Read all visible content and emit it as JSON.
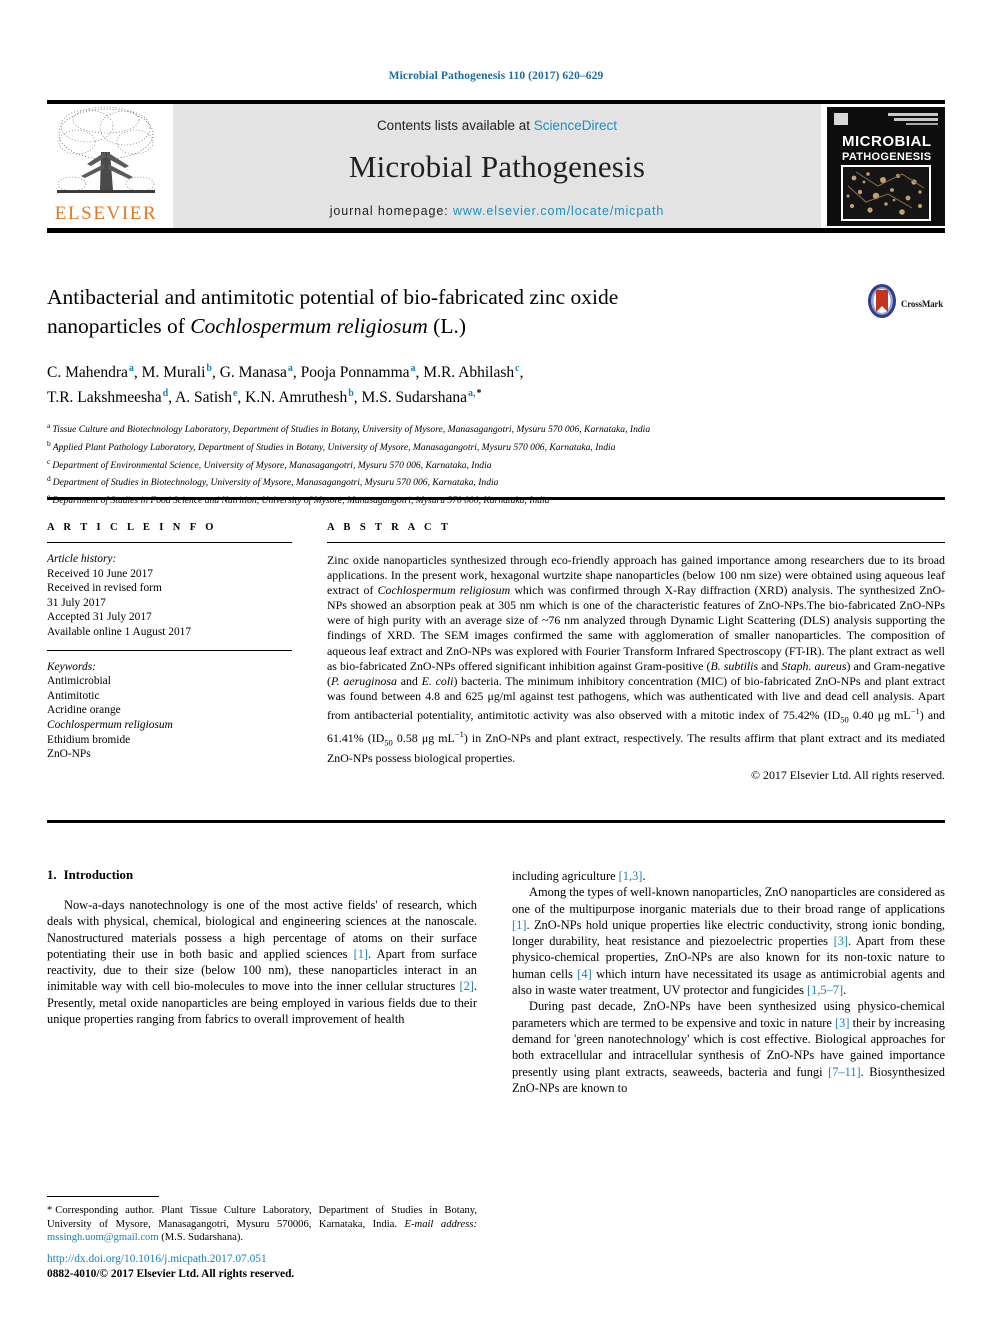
{
  "running_head": "Microbial Pathogenesis 110 (2017) 620–629",
  "masthead": {
    "contents_prefix": "Contents lists available at ",
    "sciencedirect": "ScienceDirect",
    "journal_title": "Microbial Pathogenesis",
    "homepage_label": "journal homepage: ",
    "homepage_url": "www.elsevier.com/locate/micpath",
    "publisher": "ELSEVIER",
    "cover_title_line1": "MICROBIAL",
    "cover_title_line2": "PATHOGENESIS"
  },
  "title": {
    "line1": "Antibacterial and antimitotic potential of bio-fabricated zinc oxide",
    "line2_pre": "nanoparticles of ",
    "line2_italic": "Cochlospermum religiosum",
    "line2_post": " (L.)",
    "crossmark_label": "CrossMark"
  },
  "authors": [
    {
      "name": "C. Mahendra",
      "sup": "a"
    },
    {
      "name": "M. Murali",
      "sup": "b"
    },
    {
      "name": "G. Manasa",
      "sup": "a"
    },
    {
      "name": "Pooja Ponnamma",
      "sup": "a"
    },
    {
      "name": "M.R. Abhilash",
      "sup": "c"
    },
    {
      "name": "T.R. Lakshmeesha",
      "sup": "d"
    },
    {
      "name": "A. Satish",
      "sup": "e"
    },
    {
      "name": "K.N. Amruthesh",
      "sup": "b"
    },
    {
      "name": "M.S. Sudarshana",
      "sup": "a,",
      "star": "*"
    }
  ],
  "affiliations": [
    {
      "mark": "a",
      "text": "Tissue Culture and Biotechnology Laboratory, Department of Studies in Botany, University of Mysore, Manasagangotri, Mysuru 570 006, Karnataka, India"
    },
    {
      "mark": "b",
      "text": "Applied Plant Pathology Laboratory, Department of Studies in Botany, University of Mysore, Manasagangotri, Mysuru 570 006, Karnataka, India"
    },
    {
      "mark": "c",
      "text": "Department of Environmental Science, University of Mysore, Manasagangotri, Mysuru 570 006, Karnataka, India"
    },
    {
      "mark": "d",
      "text": "Department of Studies in Biotechnology, University of Mysore, Manasagangotri, Mysuru 570 006, Karnataka, India"
    },
    {
      "mark": "e",
      "text": "Department of Studies in Food Science and Nutrition, University of Mysore, Manasagangotri, Mysuru 570 006, Karnataka, India"
    }
  ],
  "article_info": {
    "heading": "A R T I C L E   I N F O",
    "history_label": "Article history:",
    "history": [
      "Received 10 June 2017",
      "Received in revised form",
      "31 July 2017",
      "Accepted 31 July 2017",
      "Available online 1 August 2017"
    ],
    "keywords_label": "Keywords:",
    "keywords": [
      "Antimicrobial",
      "Antimitotic",
      "Acridine orange",
      "Cochlospermum religiosum",
      "Ethidium bromide",
      "ZnO-NPs"
    ]
  },
  "abstract": {
    "heading": "A B S T R A C T",
    "p1": "Zinc oxide nanoparticles synthesized through eco-friendly approach has gained importance among researchers due to its broad applications. In the present work, hexagonal wurtzite shape nanoparticles (below 100 nm size) were obtained using aqueous leaf extract of ",
    "sp1": "Cochlospermum religiosum",
    "p2": " which was confirmed through X-Ray diffraction (XRD) analysis. The synthesized ZnO-NPs showed an absorption peak at 305 nm which is one of the characteristic features of ZnO-NPs.The bio-fabricated ZnO-NPs were of high purity with an average size of ~76 nm analyzed through Dynamic Light Scattering (DLS) analysis supporting the findings of XRD. The SEM images confirmed the same with agglomeration of smaller nanoparticles. The composition of aqueous leaf extract and ZnO-NPs was explored with Fourier Transform Infrared Spectroscopy (FT-IR). The plant extract as well as bio-fabricated ZnO-NPs offered significant inhibition against Gram-positive (",
    "sp2": "B. subtilis",
    "p3": " and ",
    "sp3": "Staph. aureus",
    "p4": ") and Gram-negative (",
    "sp4": "P. aeruginosa",
    "p5": " and ",
    "sp5": "E. coli",
    "p6": ") bacteria. The minimum inhibitory concentration (MIC) of bio-fabricated ZnO-NPs and plant extract was found between 4.8 and 625 μg/ml against test pathogens, which was authenticated with live and dead cell analysis. Apart from antibacterial potentiality, antimitotic activity was also observed with a mitotic index of 75.42% (ID",
    "sub1": "50",
    "p7": " 0.40 μg mL",
    "sup1": "−1",
    "p8": ") and 61.41% (ID",
    "sub2": "50",
    "p9": " 0.58 μg mL",
    "sup2": "−1",
    "p10": ") in ZnO-NPs and plant extract, respectively. The results affirm that plant extract and its mediated ZnO-NPs possess biological properties.",
    "copyright": "© 2017 Elsevier Ltd. All rights reserved."
  },
  "sections": {
    "intro_number": "1.",
    "intro_title": "Introduction"
  },
  "body": {
    "left_p1_a": "Now-a-days nanotechnology is one of the most active fields' of research, which deals with physical, chemical, biological and engineering sciences at the nanoscale. Nanostructured materials possess a high percentage of atoms on their surface potentiating their use in both basic and applied sciences ",
    "left_ref1": "[1]",
    "left_p1_b": ". Apart from surface reactivity, due to their size (below 100 nm), these nanoparticles interact in an inimitable way with cell bio-molecules to move into the inner cellular structures ",
    "left_ref2": "[2]",
    "left_p1_c": ". Presently, metal oxide nanoparticles are being employed in various fields due to their unique properties ranging from fabrics to overall improvement of health",
    "right_p0_a": "including agriculture ",
    "right_ref0": "[1,3]",
    "right_p0_b": ".",
    "right_p1_a": "Among the types of well-known nanoparticles, ZnO nanoparticles are considered as one of the multipurpose inorganic materials due to their broad range of applications ",
    "right_ref1": "[1]",
    "right_p1_b": ". ZnO-NPs hold unique properties like electric conductivity, strong ionic bonding, longer durability, heat resistance and piezoelectric properties ",
    "right_ref2": "[3]",
    "right_p1_c": ". Apart from these physico-chemical properties, ZnO-NPs are also known for its non-toxic nature to human cells ",
    "right_ref3": "[4]",
    "right_p1_d": " which inturn have necessitated its usage as antimicrobial agents and also in waste water treatment, UV protector and fungicides ",
    "right_ref4": "[1,5–7]",
    "right_p1_e": ".",
    "right_p2_a": "During past decade, ZnO-NPs have been synthesized using physico-chemical parameters which are termed to be expensive and toxic in nature ",
    "right_ref5": "[3]",
    "right_p2_b": " their by increasing demand for 'green nanotechnology' which is cost effective. Biological approaches for both extracellular and intracellular synthesis of ZnO-NPs have gained importance presently using plant extracts, seaweeds, bacteria and fungi ",
    "right_ref6": "[7–11]",
    "right_p2_c": ". Biosynthesized ZnO-NPs are known to"
  },
  "footnote": {
    "star": "*",
    "text": "Corresponding author. Plant Tissue Culture Laboratory, Department of Studies in Botany, University of Mysore, Manasagangotri, Mysuru 570006, Karnataka, India.",
    "email_label": "E-mail address:",
    "email": "mssingh.uom@gmail.com",
    "email_owner": "(M.S. Sudarshana)."
  },
  "footer": {
    "doi": "http://dx.doi.org/10.1016/j.micpath.2017.07.051",
    "issn": "0882-4010/© 2017 Elsevier Ltd. All rights reserved."
  },
  "colors": {
    "link": "#1b7fb8",
    "sciencedirect": "#1b8fc4",
    "elsevier_orange": "#E87722",
    "masthead_bg": "#e3e3e3"
  }
}
